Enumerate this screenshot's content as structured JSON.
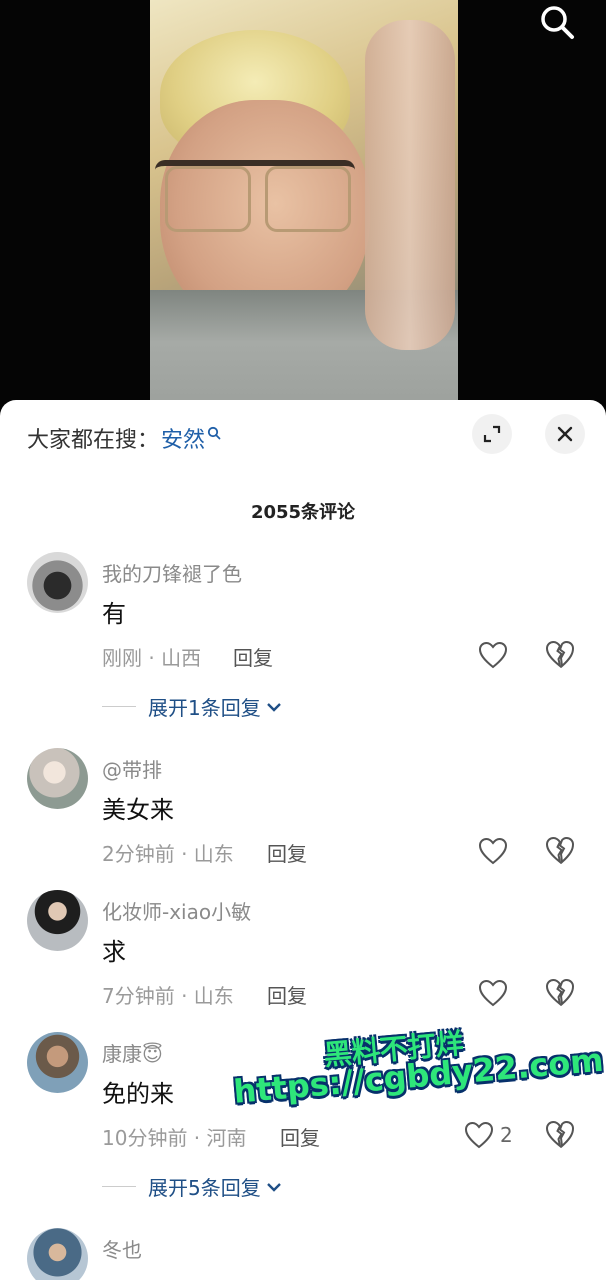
{
  "video": {
    "search_icon": "search-icon"
  },
  "sheet": {
    "trending_prefix": "大家都在搜：",
    "trending_term": "安然",
    "comment_count": "2055条评论",
    "accent_color": "#1f5fa8"
  },
  "comments": [
    {
      "username": "我的刀锋褪了色",
      "text": "有",
      "meta": "刚刚 · 山西",
      "reply": "回复",
      "likes": "",
      "expand": "展开1条回复"
    },
    {
      "username": "@带排",
      "text": "美女来",
      "meta": "2分钟前 · 山东",
      "reply": "回复",
      "likes": ""
    },
    {
      "username": "化妆师-xiao小敏",
      "text": "求",
      "meta": "7分钟前 · 山东",
      "reply": "回复",
      "likes": ""
    },
    {
      "username": "康康😇",
      "text": "免的来",
      "meta": "10分钟前 · 河南",
      "reply": "回复",
      "likes": "2",
      "expand": "展开5条回复"
    },
    {
      "username": "冬也",
      "text": "",
      "meta": "",
      "reply": "",
      "likes": ""
    }
  ],
  "watermark": {
    "line1": "黑料不打烊",
    "line2": "https://cgbdy22.com"
  }
}
